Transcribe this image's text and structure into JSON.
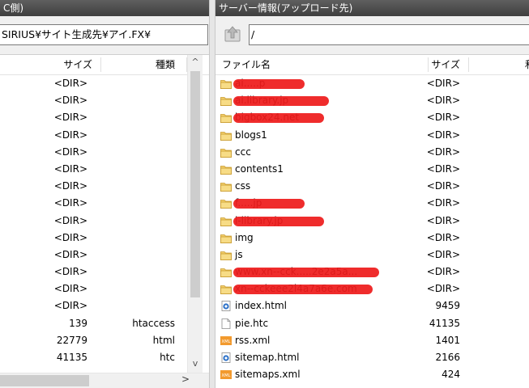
{
  "left": {
    "title": "C側)",
    "path": "SIRIUS¥サイト生成先¥アイ.FX¥",
    "headers": {
      "size": "サイズ",
      "type": "種類"
    },
    "rows": [
      {
        "size": "<DIR>",
        "type": ""
      },
      {
        "size": "<DIR>",
        "type": ""
      },
      {
        "size": "<DIR>",
        "type": ""
      },
      {
        "size": "<DIR>",
        "type": ""
      },
      {
        "size": "<DIR>",
        "type": ""
      },
      {
        "size": "<DIR>",
        "type": ""
      },
      {
        "size": "<DIR>",
        "type": ""
      },
      {
        "size": "<DIR>",
        "type": ""
      },
      {
        "size": "<DIR>",
        "type": ""
      },
      {
        "size": "<DIR>",
        "type": ""
      },
      {
        "size": "<DIR>",
        "type": ""
      },
      {
        "size": "<DIR>",
        "type": ""
      },
      {
        "size": "<DIR>",
        "type": ""
      },
      {
        "size": "<DIR>",
        "type": ""
      },
      {
        "size": "139",
        "type": "htaccess"
      },
      {
        "size": "22779",
        "type": "html"
      },
      {
        "size": "41135",
        "type": "htc"
      }
    ],
    "scroll": {
      "up": "^",
      "down": "v",
      "right": ">"
    }
  },
  "right": {
    "title": "サーバー情報(アップロード先)",
    "path": "/",
    "headers": {
      "name": "ファイル名",
      "size": "サイズ",
      "extra": "和"
    },
    "rows": [
      {
        "name": "ai.....p",
        "size": "<DIR>",
        "icon": "folder-icon",
        "redacted": true
      },
      {
        "name": "ai.library.jp",
        "size": "<DIR>",
        "icon": "folder-icon",
        "redacted": true
      },
      {
        "name": "bigbox24.net",
        "size": "<DIR>",
        "icon": "folder-icon",
        "redacted": true
      },
      {
        "name": "blogs1",
        "size": "<DIR>",
        "icon": "folder-icon",
        "redacted": false
      },
      {
        "name": "ccc",
        "size": "<DIR>",
        "icon": "folder-icon",
        "redacted": false
      },
      {
        "name": "contents1",
        "size": "<DIR>",
        "icon": "folder-icon",
        "redacted": false
      },
      {
        "name": "css",
        "size": "<DIR>",
        "icon": "folder-icon",
        "redacted": false
      },
      {
        "name": "f.....jp",
        "size": "<DIR>",
        "icon": "folder-icon",
        "redacted": true
      },
      {
        "name": "i-library.jp",
        "size": "<DIR>",
        "icon": "folder-icon",
        "redacted": true
      },
      {
        "name": "img",
        "size": "<DIR>",
        "icon": "folder-icon",
        "redacted": false
      },
      {
        "name": "js",
        "size": "<DIR>",
        "icon": "folder-icon",
        "redacted": false
      },
      {
        "name": "www.xn--cck.....2e2a5a...",
        "size": "<DIR>",
        "icon": "folder-icon",
        "redacted": true
      },
      {
        "name": "xn--cckeee2l4a7a6e.com",
        "size": "<DIR>",
        "icon": "folder-icon",
        "redacted": true
      },
      {
        "name": "index.html",
        "size": "9459",
        "icon": "html-file-icon",
        "redacted": false
      },
      {
        "name": "pie.htc",
        "size": "41135",
        "icon": "blank-file-icon",
        "redacted": false
      },
      {
        "name": "rss.xml",
        "size": "1401",
        "icon": "xml-file-icon",
        "redacted": false
      },
      {
        "name": "sitemap.html",
        "size": "2166",
        "icon": "html-file-icon",
        "redacted": false
      },
      {
        "name": "sitemaps.xml",
        "size": "424",
        "icon": "xml-file-icon",
        "redacted": false
      }
    ],
    "xml_badge": "XML"
  }
}
